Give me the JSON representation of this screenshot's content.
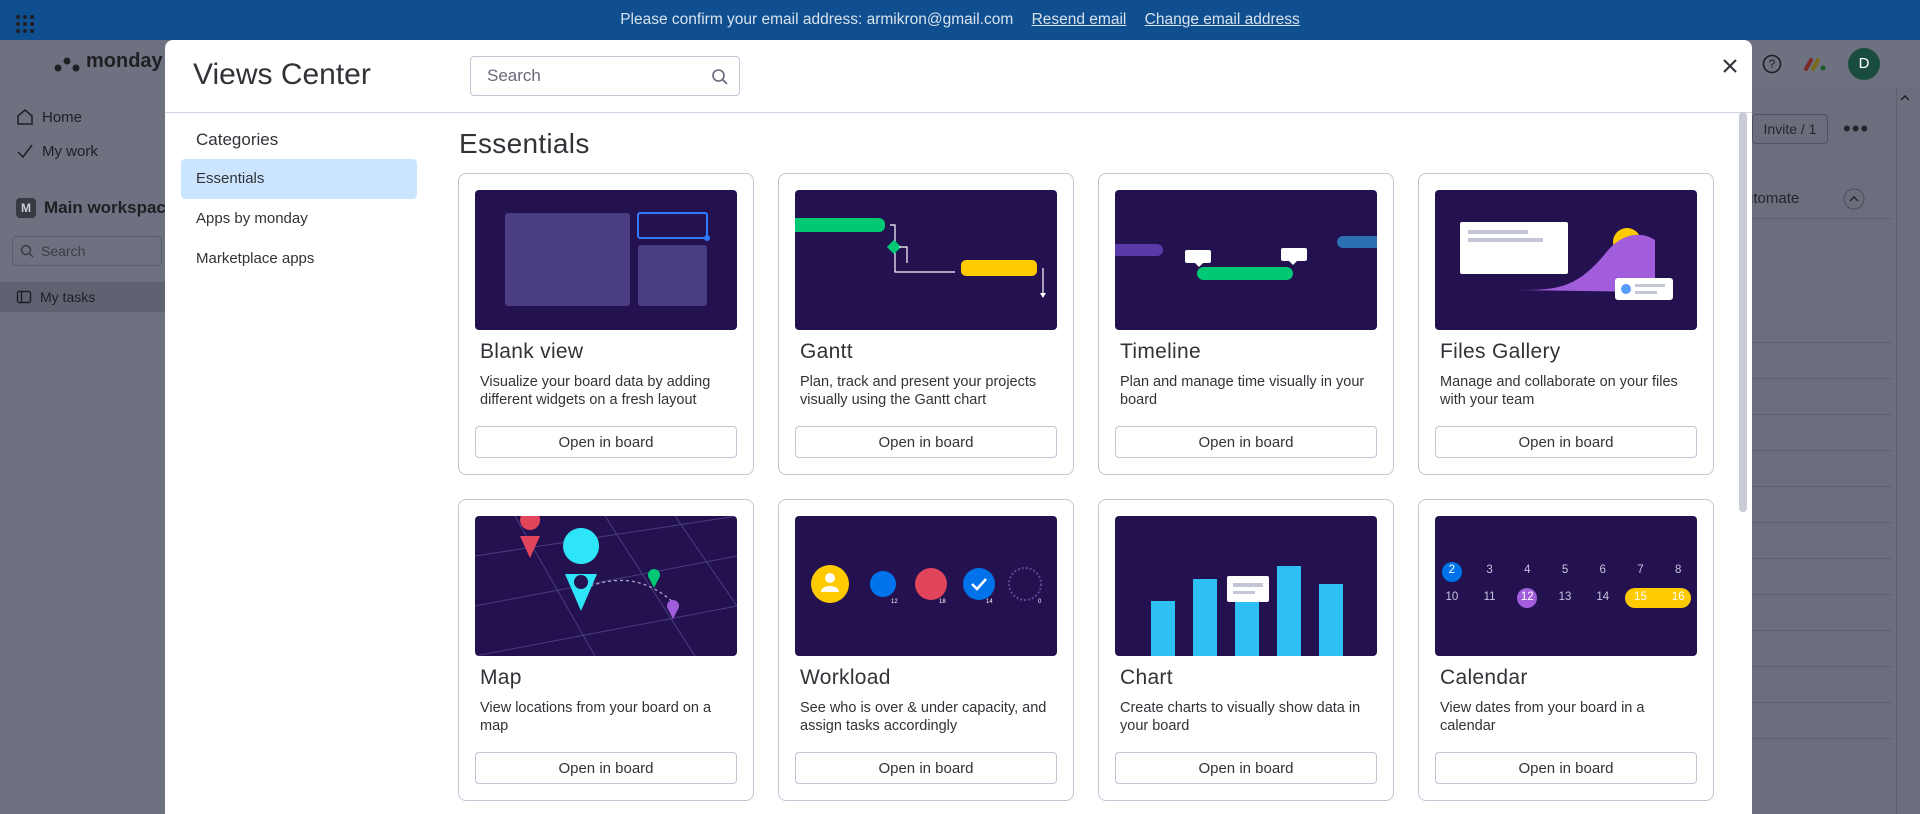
{
  "banner": {
    "message": "Please confirm your email address: armikron@gmail.com",
    "resend": "Resend email",
    "change": "Change email address"
  },
  "app": {
    "logo_text": "monday w",
    "invite_label": "Invite / 1",
    "automate_label": "utomate",
    "avatar_initial": "D"
  },
  "sidebar": {
    "home": "Home",
    "my_work": "My work",
    "workspace_badge": "M",
    "workspace_name": "Main workspace",
    "search_placeholder": "Search",
    "task_item": "My tasks"
  },
  "modal": {
    "title": "Views Center",
    "search_placeholder": "Search",
    "categories_title": "Categories",
    "categories": [
      {
        "label": "Essentials",
        "active": true
      },
      {
        "label": "Apps by monday",
        "active": false
      },
      {
        "label": "Marketplace apps",
        "active": false
      }
    ],
    "section_title": "Essentials",
    "button_label": "Open in board",
    "cards": [
      {
        "title": "Blank view",
        "desc": "Visualize your board data by adding different widgets on a fresh layout",
        "image": "blank-view-illustration"
      },
      {
        "title": "Gantt",
        "desc": "Plan, track and present your projects visually using the Gantt chart",
        "image": "gantt-illustration"
      },
      {
        "title": "Timeline",
        "desc": "Plan and manage time visually in your board",
        "image": "timeline-illustration"
      },
      {
        "title": "Files Gallery",
        "desc": "Manage and collaborate on your files with your team",
        "image": "files-gallery-illustration"
      },
      {
        "title": "Map",
        "desc": "View locations from your board on a map",
        "image": "map-illustration"
      },
      {
        "title": "Workload",
        "desc": "See who is over & under capacity, and assign tasks accordingly",
        "image": "workload-illustration"
      },
      {
        "title": "Chart",
        "desc": "Create charts to visually show data in your board",
        "image": "chart-illustration"
      },
      {
        "title": "Calendar",
        "desc": "View dates from your board in a calendar",
        "image": "calendar-illustration"
      }
    ],
    "workload_numbers": [
      "12",
      "18",
      "14",
      "0"
    ],
    "calendar_days_row1": [
      "2",
      "3",
      "4",
      "5",
      "6",
      "7",
      "8"
    ],
    "calendar_days_row2": [
      "10",
      "11",
      "12",
      "13",
      "14",
      "15",
      "16"
    ]
  },
  "colors": {
    "accent": "#0073ea",
    "active_category": "#cce5ff",
    "illustration_bg": "#23124f",
    "banner": "#0f4f8f"
  }
}
